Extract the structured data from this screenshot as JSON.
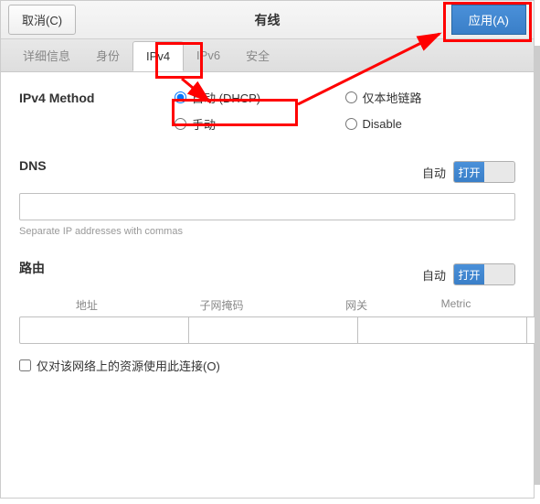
{
  "titlebar": {
    "cancel": "取消(C)",
    "title": "有线",
    "apply": "应用(A)"
  },
  "tabs": {
    "items": [
      {
        "label": "详细信息"
      },
      {
        "label": "身份"
      },
      {
        "label": "IPv4"
      },
      {
        "label": "IPv6"
      },
      {
        "label": "安全"
      }
    ]
  },
  "ipv4": {
    "method_label": "IPv4 Method",
    "options": {
      "auto": "自动 (DHCP)",
      "local": "仅本地链路",
      "manual": "手动",
      "disable": "Disable"
    }
  },
  "dns": {
    "label": "DNS",
    "auto_label": "自动",
    "switch_on": "打开",
    "hint": "Separate IP addresses with commas"
  },
  "routes": {
    "label": "路由",
    "auto_label": "自动",
    "switch_on": "打开",
    "headers": {
      "address": "地址",
      "netmask": "子网掩码",
      "gateway": "网关",
      "metric": "Metric"
    },
    "checkbox": "仅对该网络上的资源使用此连接(O)"
  },
  "icons": {
    "delete": "✖"
  }
}
